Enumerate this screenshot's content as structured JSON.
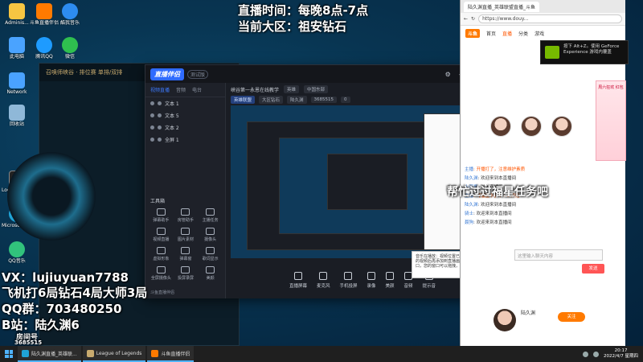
{
  "overlay": {
    "stream_time": "直播时间：每晚8点-7点",
    "server": "当前大区：祖安钻石",
    "vx": "VX：lujiuyuan7788",
    "record": "飞机打6局钻石4局大师3局",
    "qq_group": "QQ群：703480250",
    "bilibili": "B站：陆久渊6",
    "room_label": "房间号",
    "room_id": "3685515",
    "banner": "帮忙过过福星任务吧"
  },
  "desktop_icons": [
    {
      "label": "Adminis...",
      "color": "#f5c542"
    },
    {
      "label": "斗鱼直播伴侣",
      "color": "#ff7a00"
    },
    {
      "label": "酷我音乐",
      "color": "#2d8cf0"
    },
    {
      "label": "此电脑",
      "color": "#4aa3ff"
    },
    {
      "label": "腾讯QQ",
      "color": "#1e9bff"
    },
    {
      "label": "微信",
      "color": "#2fbf4f"
    },
    {
      "label": "Network",
      "color": "#4aa3ff"
    },
    {
      "label": "回收站",
      "color": "#8fb8d8"
    },
    {
      "label": "Logitech G HUB",
      "color": "#222222"
    },
    {
      "label": "Microsoft Edge",
      "color": "#1fa3d6"
    },
    {
      "label": "QQ音乐",
      "color": "#31c27c"
    }
  ],
  "lol_window": {
    "title": "召唤师峡谷 · 排位赛 单排/双排"
  },
  "stream_app": {
    "logo": "直播伴侣",
    "version": "测试版",
    "window_controls": [
      "⚙",
      "—",
      "□",
      "✕"
    ],
    "tabs": [
      "视频直播",
      "音频",
      "电台"
    ],
    "sources": [
      "文本 1",
      "文本 5",
      "文本 2",
      "全屏 1"
    ],
    "tools_title": "工具箱",
    "tools": [
      "弹幕助手",
      "房管助手",
      "主播任务",
      "视频直播",
      "图片素材",
      "摄像头",
      "虚拟形象",
      "弹幕窗",
      "歌词显示",
      "全屏摄像头",
      "投屏录屏",
      "美颜"
    ],
    "bottom_hint": "斗鱼直播伴侣",
    "room_title": "峡谷第一永恩在线教学",
    "category_chip": "英雄",
    "quality_chip": "中国东部",
    "live_mode_chip": "英雄联盟",
    "rank_chip": "大区钻石",
    "streamer": "陆久渊",
    "room_number": "3685515",
    "likes": "0",
    "toolbar": [
      "直播屏幕",
      "麦克风",
      "手机投屏",
      "录像",
      "美颜",
      "音频",
      "提示音"
    ]
  },
  "tooltip": {
    "text": "音乐在播放：视频位置已满时，若需更换请先删除旧的视频后再添加到直播画面中。Ctrl+Z切换文本/窗口，您的窗口可以拖拽，左侧\"同意\"选择。"
  },
  "browser": {
    "tab_title": "陆久渊直播_英雄联盟直播_斗鱼",
    "address": "https://www.douy...",
    "nav": [
      "首页",
      "直播",
      "分类",
      "游戏"
    ],
    "nav_active": "直播",
    "chat": [
      {
        "name": "主播",
        "msg": "开播打了，注意维护素质",
        "sys": true
      },
      {
        "name": "陆久渊",
        "msg": "欢迎来到本直播间",
        "sys": false
      },
      {
        "name": "小可爱",
        "msg": "进入直播间",
        "sys": false
      },
      {
        "name": "主播",
        "msg": "【福星卡】下+1 开始",
        "sys": true
      },
      {
        "name": "陆久渊",
        "msg": "欢迎来到本直播间",
        "sys": false
      },
      {
        "name": "骑士",
        "msg": "欢迎来到本直播间",
        "sys": false
      },
      {
        "name": "聂狗",
        "msg": "欢迎来到本直播间",
        "sys": false
      }
    ],
    "promo": "周六狂欢 红包",
    "chat_placeholder": "这里输入聊天内容",
    "send": "发送",
    "host_name": "陆久渊",
    "follow": "关注"
  },
  "geforce": {
    "text": "按下 Alt+Z。使用 GeForce Experience 游戏内覆盖"
  },
  "taskbar": {
    "items": [
      {
        "label": "陆久渊直播_英雄联...",
        "color": "#1fa3d6"
      },
      {
        "label": "League of Legends",
        "color": "#c8aa6e"
      },
      {
        "label": "斗鱼直播伴侣",
        "color": "#ff7a00"
      }
    ],
    "time": "20:17",
    "date": "2022/4/7 星期四"
  }
}
